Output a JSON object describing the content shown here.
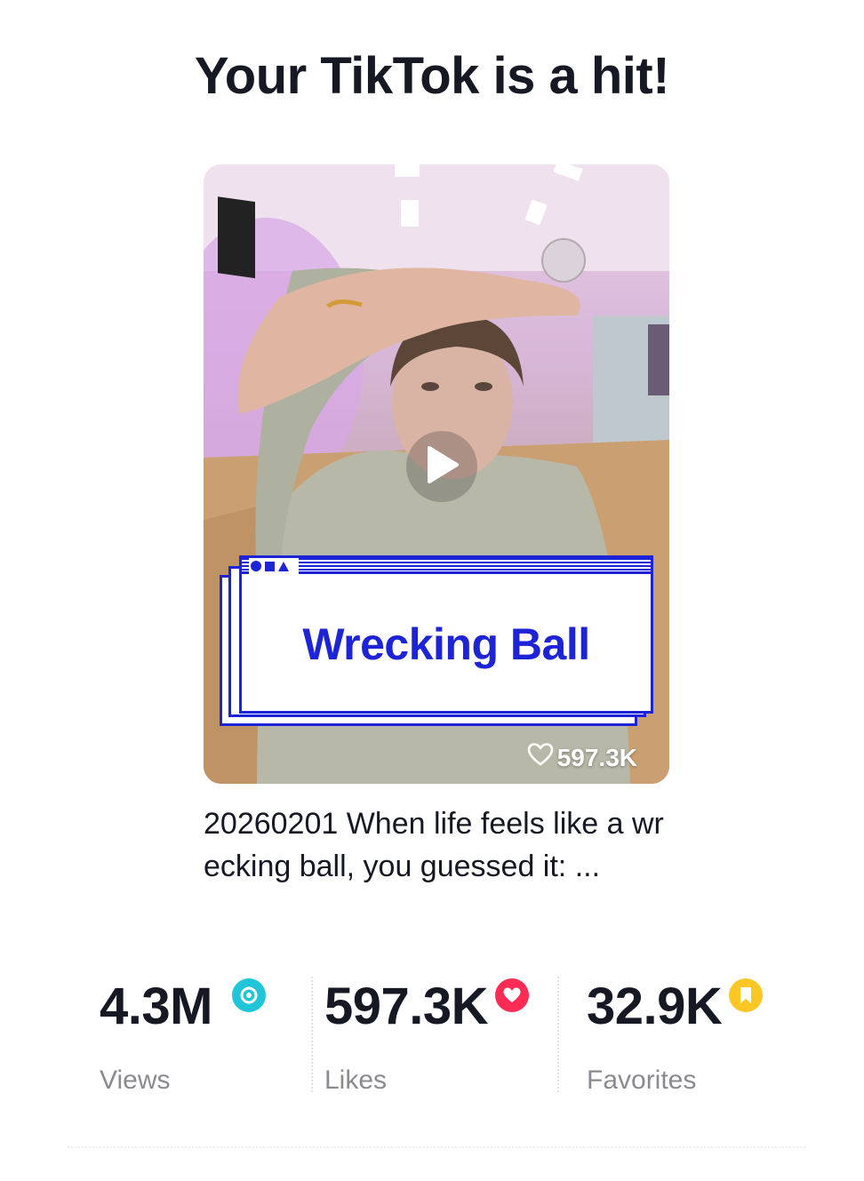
{
  "header": {
    "title": "Your TikTok is a hit!"
  },
  "video": {
    "overlay_title": "Wrecking Ball",
    "like_count": "597.3K",
    "caption": "20260201 When life feels like a wrecking ball, you guessed it: ..."
  },
  "stats": [
    {
      "value": "4.3M",
      "label": "Views",
      "icon": "eye-icon",
      "color": "#20c5d8"
    },
    {
      "value": "597.3K",
      "label": "Likes",
      "icon": "heart-icon",
      "color": "#fe2c55"
    },
    {
      "value": "32.9K",
      "label": "Favorites",
      "icon": "bookmark-icon",
      "color": "#fcc624"
    }
  ],
  "colors": {
    "accent_blue": "#1d23d6",
    "text": "#161823",
    "muted": "#8a8b91"
  }
}
